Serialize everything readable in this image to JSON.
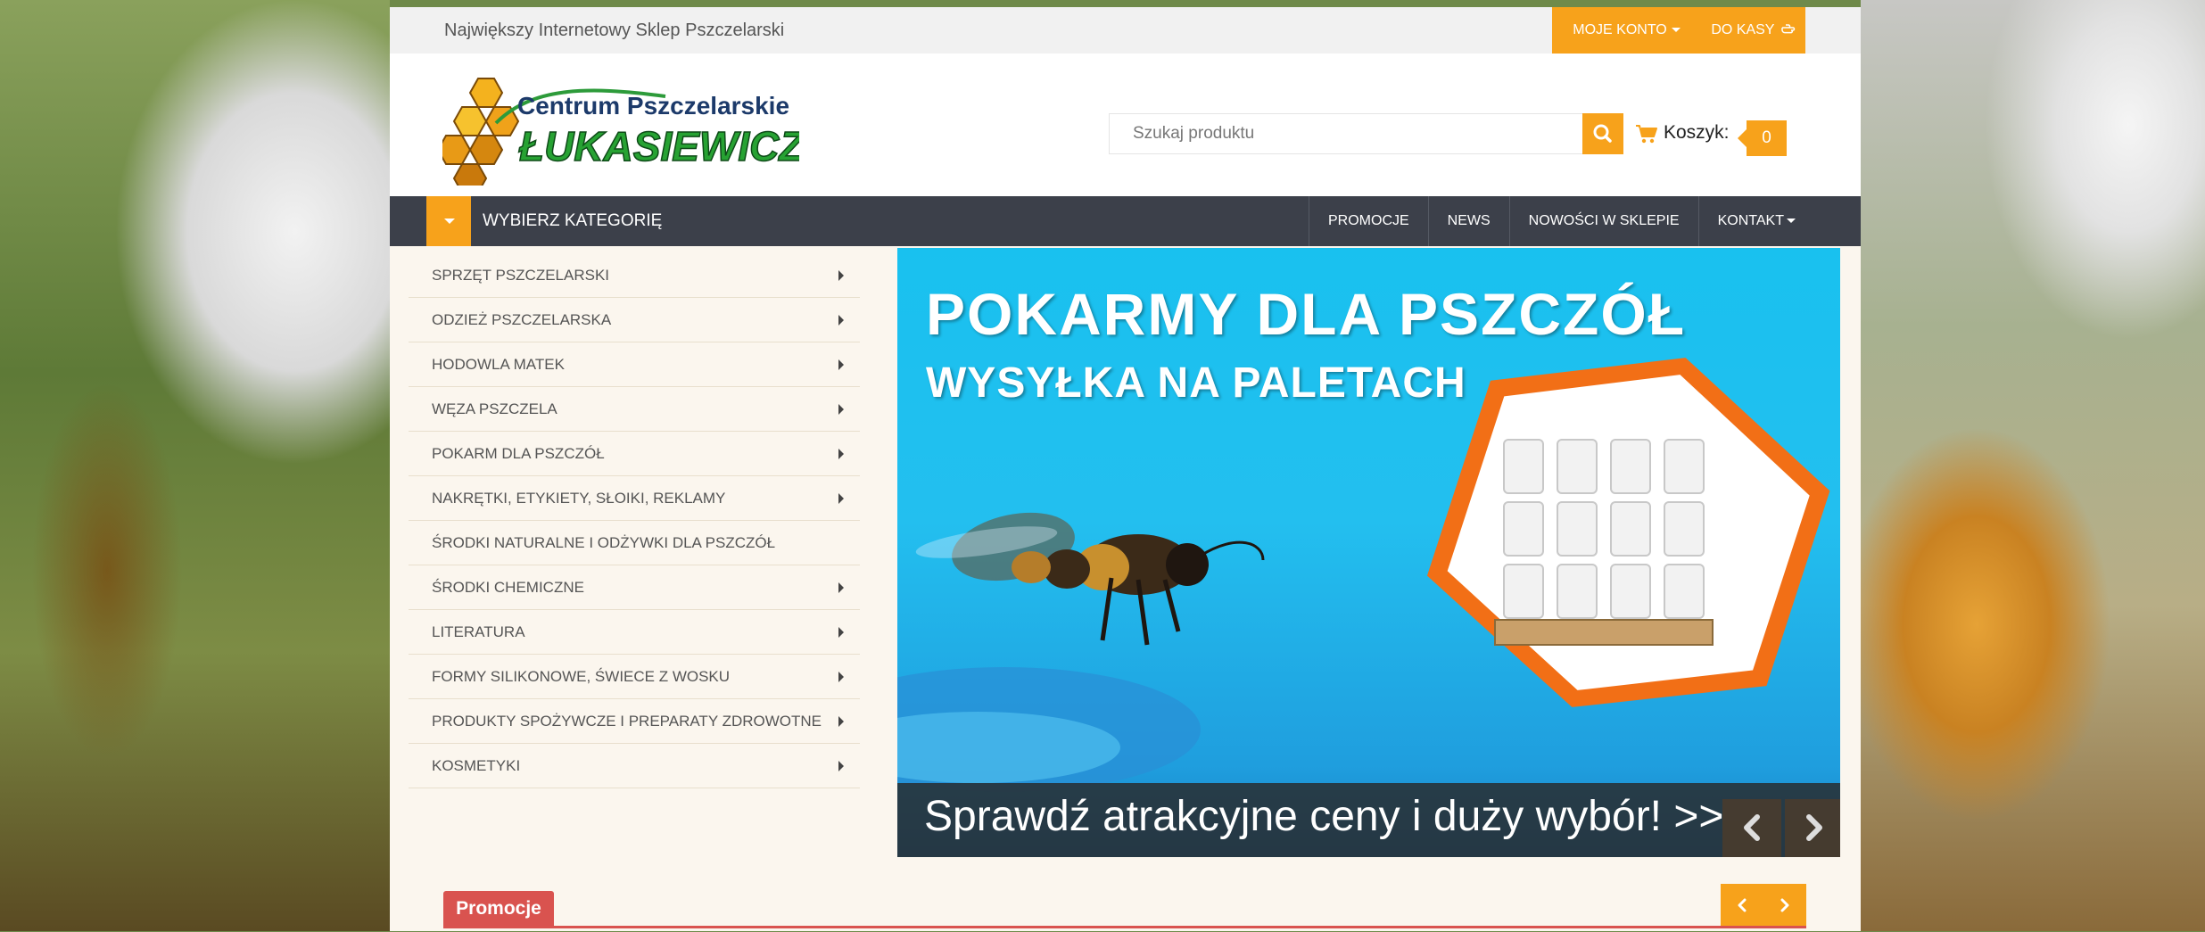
{
  "topbar": {
    "tagline": "Największy Internetowy Sklep Pszczelarski",
    "account_label": "MOJE KONTO",
    "checkout_label": "DO KASY"
  },
  "logo": {
    "line1": "Centrum Pszczelarskie",
    "line2": "ŁUKASIEWICZ"
  },
  "search": {
    "placeholder": "Szukaj produktu"
  },
  "cart": {
    "label": "Koszyk:",
    "count": "0"
  },
  "nav": {
    "category_label": "WYBIERZ KATEGORIĘ",
    "links": [
      "PROMOCJE",
      "NEWS",
      "NOWOŚCI W SKLEPIE",
      "KONTAKT"
    ]
  },
  "categories": [
    {
      "label": "SPRZĘT PSZCZELARSKI",
      "has_sub": true
    },
    {
      "label": "ODZIEŻ PSZCZELARSKA",
      "has_sub": true
    },
    {
      "label": "HODOWLA MATEK",
      "has_sub": true
    },
    {
      "label": "WĘZA PSZCZELA",
      "has_sub": true
    },
    {
      "label": "POKARM DLA PSZCZÓŁ",
      "has_sub": true
    },
    {
      "label": "NAKRĘTKI, ETYKIETY, SŁOIKI, REKLAMY",
      "has_sub": true
    },
    {
      "label": "ŚRODKI NATURALNE I ODŻYWKI DLA PSZCZÓŁ",
      "has_sub": false
    },
    {
      "label": "ŚRODKI CHEMICZNE",
      "has_sub": true
    },
    {
      "label": "LITERATURA",
      "has_sub": true
    },
    {
      "label": "FORMY SILIKONOWE, ŚWIECE Z WOSKU",
      "has_sub": true
    },
    {
      "label": "PRODUKTY SPOŻYWCZE I PREPARATY ZDROWOTNE",
      "has_sub": true
    },
    {
      "label": "KOSMETYKI",
      "has_sub": true
    }
  ],
  "banner": {
    "title1": "POKARMY DLA PSZCZÓŁ",
    "title2": "WYSYŁKA NA PALETACH",
    "caption": "Sprawdź atrakcyjne ceny i duży wybór! >>"
  },
  "promo": {
    "label": "Promocje"
  },
  "colors": {
    "accent": "#f7a21b",
    "nav_bg": "#3c404a",
    "promo_red": "#d9534f",
    "banner_blue": "#1fbff0",
    "hex_orange": "#f26f16"
  }
}
